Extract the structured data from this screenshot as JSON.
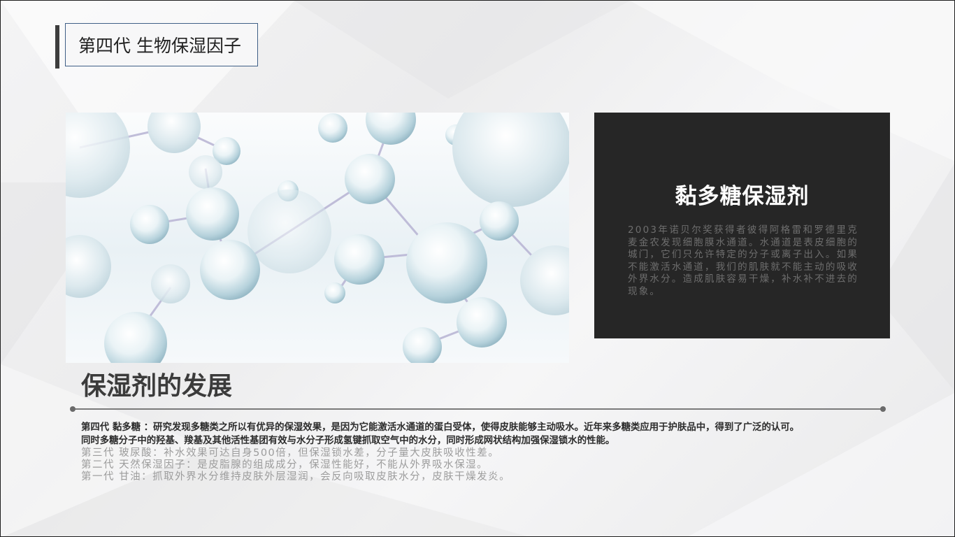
{
  "slide": {
    "title": "第四代 生物保湿因子",
    "image_alt": "molecular-structure-illustration",
    "card": {
      "title": "黏多糖保湿剂",
      "body": "2003年诺贝尔奖获得者彼得阿格雷和罗德里克麦金农发现细胞膜水通道。水通道是表皮细胞的城门，它们只允许特定的分子或离子出入。如果不能激活水通道，我们的肌肤就不能主动的吸收外界水分。造成肌肤容易干燥，补水补不进去的现象。"
    },
    "section_heading": "保湿剂的发展",
    "paragraphs": [
      "第四代  黏多糖  ：研究发现多糖类之所以有优异的保湿效果，是因为它能激活水通道的蛋白受体，使得皮肤能够主动吸水。近年来多糖类应用于护肤品中，得到了广泛的认可。",
      "同时多糖分子中的羟基、羧基及其他活性基团有效与水分子形成氢键抓取空气中的水分，同时形成网状结构加强保湿锁水的性能。",
      "第三代  玻尿酸：补水效果可达自身500倍，但保湿锁水差，分子量大皮肤吸收性差。",
      "第二代  天然保湿因子：是皮脂腺的组成成分，保湿性能好，不能从外界吸水保湿。",
      "第一代  甘油：抓取外界水分维持皮肤外层湿润，会反向吸取皮肤水分，皮肤干燥发炎。"
    ]
  },
  "colors": {
    "title_border": "#3f5f86",
    "card_background": "#262626",
    "molecule": "#a9c9d6"
  }
}
